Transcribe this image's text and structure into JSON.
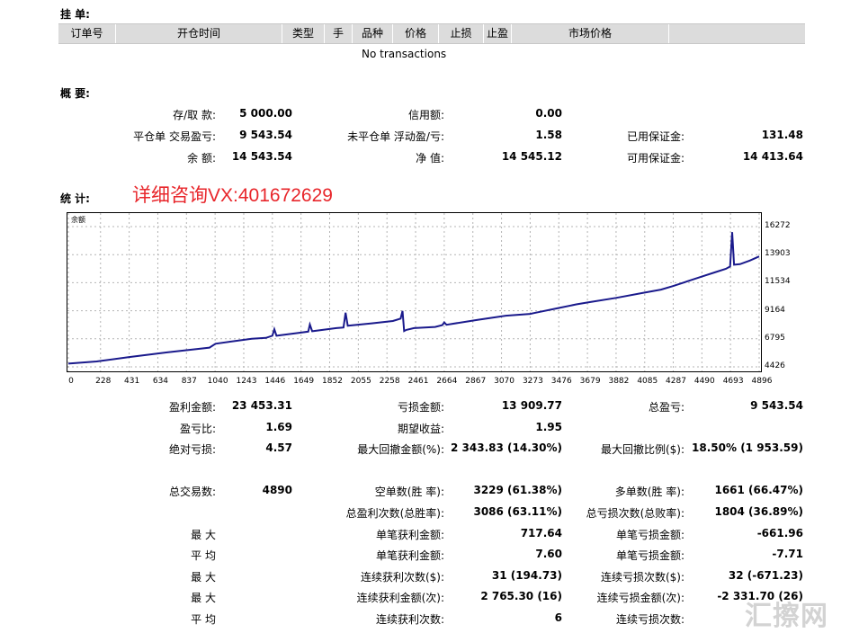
{
  "orders": {
    "title": "挂 单:",
    "columns": [
      "订单号",
      "开仓时间",
      "类型",
      "手",
      "品种",
      "价格",
      "止损",
      "止盈",
      "市场价格"
    ],
    "empty_text": "No transactions"
  },
  "summary": {
    "title": "概 要:",
    "rows": [
      [
        {
          "label": "存/取 款:",
          "value": "5 000.00"
        },
        {
          "label": "信用额:",
          "value": "0.00"
        },
        {
          "label": "",
          "value": ""
        }
      ],
      [
        {
          "label": "平仓单 交易盈亏:",
          "value": "9 543.54"
        },
        {
          "label": "未平仓单 浮动盈/亏:",
          "value": "1.58"
        },
        {
          "label": "已用保证金:",
          "value": "131.48"
        }
      ],
      [
        {
          "label": "余 额:",
          "value": "14 543.54"
        },
        {
          "label": "净 值:",
          "value": "14 545.12"
        },
        {
          "label": "可用保证金:",
          "value": "14 413.64"
        }
      ]
    ]
  },
  "stats": {
    "title": "统 计:",
    "note": "详细咨询VX:401672629"
  },
  "chart_data": {
    "type": "line",
    "title": "余额",
    "series": [
      {
        "name": "余额",
        "color": "#1a1a8c",
        "points": [
          [
            0,
            4700
          ],
          [
            200,
            4880
          ],
          [
            431,
            5250
          ],
          [
            700,
            5650
          ],
          [
            1000,
            6050
          ],
          [
            1043,
            6380
          ],
          [
            1300,
            6800
          ],
          [
            1400,
            6870
          ],
          [
            1446,
            7050
          ],
          [
            1460,
            7600
          ],
          [
            1475,
            7050
          ],
          [
            1649,
            7320
          ],
          [
            1700,
            7400
          ],
          [
            1712,
            8000
          ],
          [
            1728,
            7430
          ],
          [
            1900,
            7700
          ],
          [
            1950,
            7750
          ],
          [
            1965,
            9000
          ],
          [
            1980,
            7900
          ],
          [
            2150,
            8100
          ],
          [
            2300,
            8300
          ],
          [
            2355,
            8500
          ],
          [
            2368,
            9150
          ],
          [
            2380,
            7450
          ],
          [
            2395,
            7550
          ],
          [
            2450,
            7700
          ],
          [
            2600,
            7800
          ],
          [
            2650,
            7950
          ],
          [
            2664,
            8180
          ],
          [
            2680,
            7980
          ],
          [
            2900,
            8400
          ],
          [
            3100,
            8750
          ],
          [
            3273,
            8900
          ],
          [
            3300,
            8970
          ],
          [
            3476,
            9400
          ],
          [
            3600,
            9700
          ],
          [
            3700,
            9900
          ],
          [
            3882,
            10250
          ],
          [
            4085,
            10700
          ],
          [
            4200,
            10950
          ],
          [
            4287,
            11250
          ],
          [
            4400,
            11700
          ],
          [
            4490,
            12050
          ],
          [
            4580,
            12400
          ],
          [
            4660,
            12700
          ],
          [
            4690,
            12900
          ],
          [
            4705,
            15800
          ],
          [
            4718,
            13050
          ],
          [
            4760,
            13100
          ],
          [
            4830,
            13400
          ],
          [
            4896,
            13750
          ]
        ]
      }
    ],
    "x_ticks": [
      0,
      228,
      431,
      634,
      837,
      1040,
      1243,
      1446,
      1649,
      1852,
      2055,
      2258,
      2461,
      2664,
      2867,
      3070,
      3273,
      3476,
      3679,
      3882,
      4085,
      4287,
      4490,
      4693,
      4896
    ],
    "y_ticks": [
      4426,
      6795,
      9164,
      11534,
      13903,
      16272
    ],
    "xlim": [
      0,
      4896
    ],
    "ylim": [
      4426,
      16272
    ],
    "grid": true,
    "legend": "top-left"
  },
  "stats_rows": [
    [
      {
        "label": "盈利金额:",
        "value": "23 453.31"
      },
      {
        "label": "亏损金额:",
        "value": "13 909.77"
      },
      {
        "label": "总盈亏:",
        "value": "9 543.54"
      }
    ],
    [
      {
        "label": "盈亏比:",
        "value": "1.69"
      },
      {
        "label": "期望收益:",
        "value": "1.95"
      },
      {
        "label": "",
        "value": ""
      }
    ],
    [
      {
        "label": "绝对亏损:",
        "value": "4.57"
      },
      {
        "label": "最大回撤金额(%):",
        "value": "2 343.83 (14.30%)"
      },
      {
        "label": "最大回撤比例($):",
        "value": "18.50% (1 953.59)"
      }
    ],
    [
      {
        "label": "",
        "value": ""
      },
      {
        "label": "",
        "value": ""
      },
      {
        "label": "",
        "value": ""
      }
    ],
    [
      {
        "label": "总交易数:",
        "value": "4890"
      },
      {
        "label": "空单数(胜 率):",
        "value": "3229 (61.38%)"
      },
      {
        "label": "多单数(胜 率):",
        "value": "1661 (66.47%)"
      }
    ],
    [
      {
        "label": "",
        "value": ""
      },
      {
        "label": "总盈利次数(总胜率):",
        "value": "3086 (63.11%)"
      },
      {
        "label": "总亏损次数(总败率):",
        "value": "1804 (36.89%)"
      }
    ],
    [
      {
        "label": "最 大",
        "value": ""
      },
      {
        "label": "单笔获利金额:",
        "value": "717.64"
      },
      {
        "label": "单笔亏损金额:",
        "value": "-661.96"
      }
    ],
    [
      {
        "label": "平 均",
        "value": ""
      },
      {
        "label": "单笔获利金额:",
        "value": "7.60"
      },
      {
        "label": "单笔亏损金额:",
        "value": "-7.71"
      }
    ],
    [
      {
        "label": "最 大",
        "value": ""
      },
      {
        "label": "连续获利次数($):",
        "value": "31 (194.73)"
      },
      {
        "label": "连续亏损次数($):",
        "value": "32 (-671.23)"
      }
    ],
    [
      {
        "label": "最 大",
        "value": ""
      },
      {
        "label": "连续获利金额(次):",
        "value": "2 765.30 (16)"
      },
      {
        "label": "连续亏损金额(次):",
        "value": "-2 331.70 (26)"
      }
    ],
    [
      {
        "label": "平 均",
        "value": ""
      },
      {
        "label": "连续获利次数:",
        "value": "6"
      },
      {
        "label": "连续亏损次数:",
        "value": ""
      }
    ]
  ],
  "watermark": "汇擦网"
}
